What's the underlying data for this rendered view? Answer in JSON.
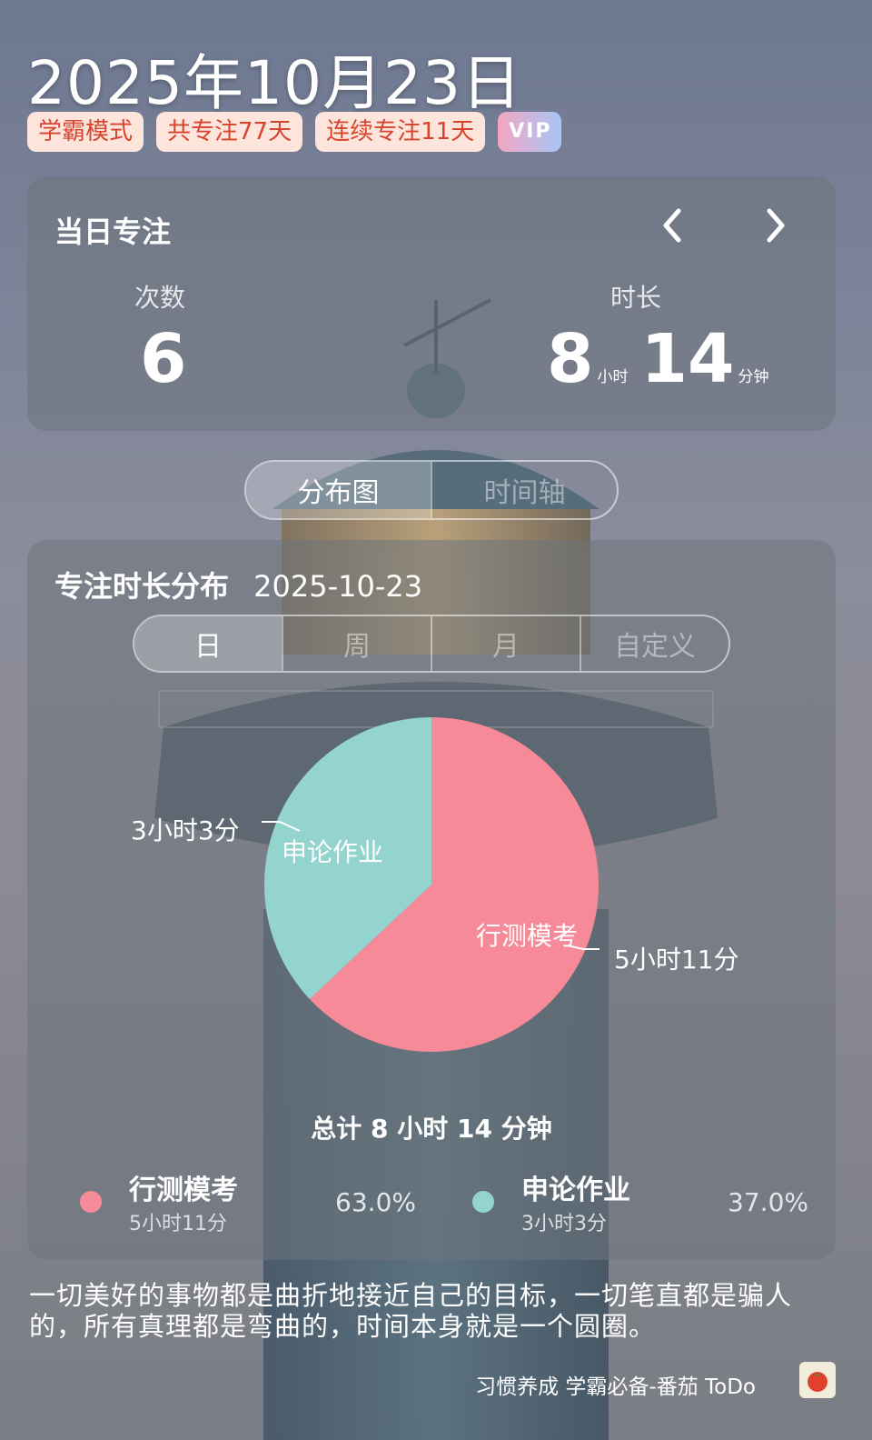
{
  "header": {
    "date": "2025年10月23日",
    "badges": [
      "学霸模式",
      "共专注77天",
      "连续专注11天"
    ],
    "vip": "VIP"
  },
  "daily": {
    "title": "当日专注",
    "count_label": "次数",
    "count_value": "6",
    "duration_label": "时长",
    "hours": "8",
    "hours_unit": "小时",
    "minutes": "14",
    "minutes_unit": "分钟"
  },
  "view_toggle": {
    "options": [
      "分布图",
      "时间轴"
    ],
    "active": 0
  },
  "distribution": {
    "title": "专注时长分布",
    "date": "2025-10-23",
    "range_tabs": [
      "日",
      "周",
      "月",
      "自定义"
    ],
    "active_range": 0,
    "total": "总计 8 小时 14 分钟"
  },
  "chart_data": {
    "type": "pie",
    "slices": [
      {
        "name": "行测模考",
        "value": 63.0,
        "minutes": 311,
        "duration": "5小时11分",
        "percent": "63.0%",
        "color": "#f78a98"
      },
      {
        "name": "申论作业",
        "value": 37.0,
        "minutes": 183,
        "duration": "3小时3分",
        "percent": "37.0%",
        "color": "#93d4cf"
      }
    ]
  },
  "quote": "一切美好的事物都是曲折地接近自己的目标，一切笔直都是骗人的，所有真理都是弯曲的，时间本身就是一个圆圈。",
  "footer": {
    "text": "习惯养成 学霸必备-番茄 ToDo"
  }
}
